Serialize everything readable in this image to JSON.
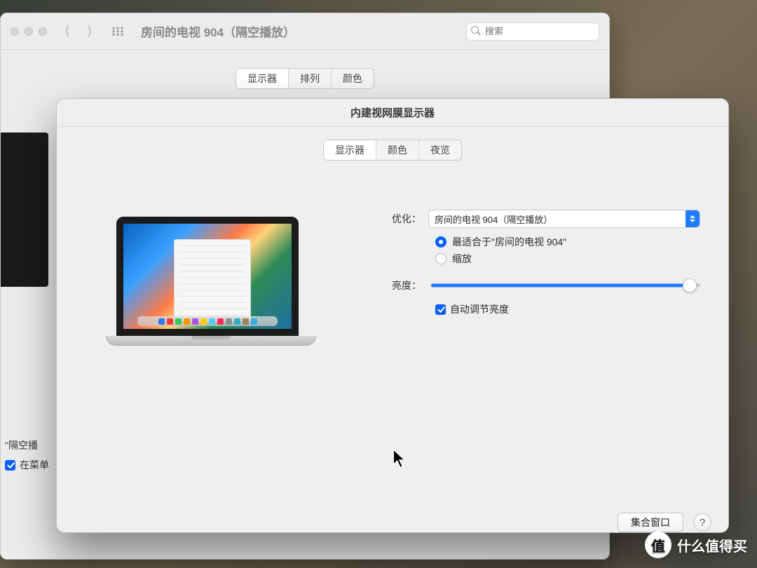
{
  "back_window": {
    "title": "房间的电视 904（隔空播放）",
    "search_placeholder": "搜索",
    "tabs": {
      "display": "显示器",
      "arrange": "排列",
      "color": "颜色"
    },
    "bottom": {
      "airplay_partial": "\"隔空播",
      "menubar_partial": "在菜单"
    }
  },
  "front_window": {
    "title": "内建视网膜显示器",
    "tabs": {
      "display": "显示器",
      "color": "颜色",
      "night": "夜览"
    },
    "optimize_label": "优化：",
    "optimize_value": "房间的电视 904（隔空播放）",
    "radio_best": "最适合于\"房间的电视 904\"",
    "radio_scaled": "缩放",
    "brightness_label": "亮度：",
    "auto_brightness": "自动调节亮度",
    "gather_button": "集合窗口",
    "help": "?"
  },
  "watermark": "什么值得买",
  "watermark_badge": "值"
}
